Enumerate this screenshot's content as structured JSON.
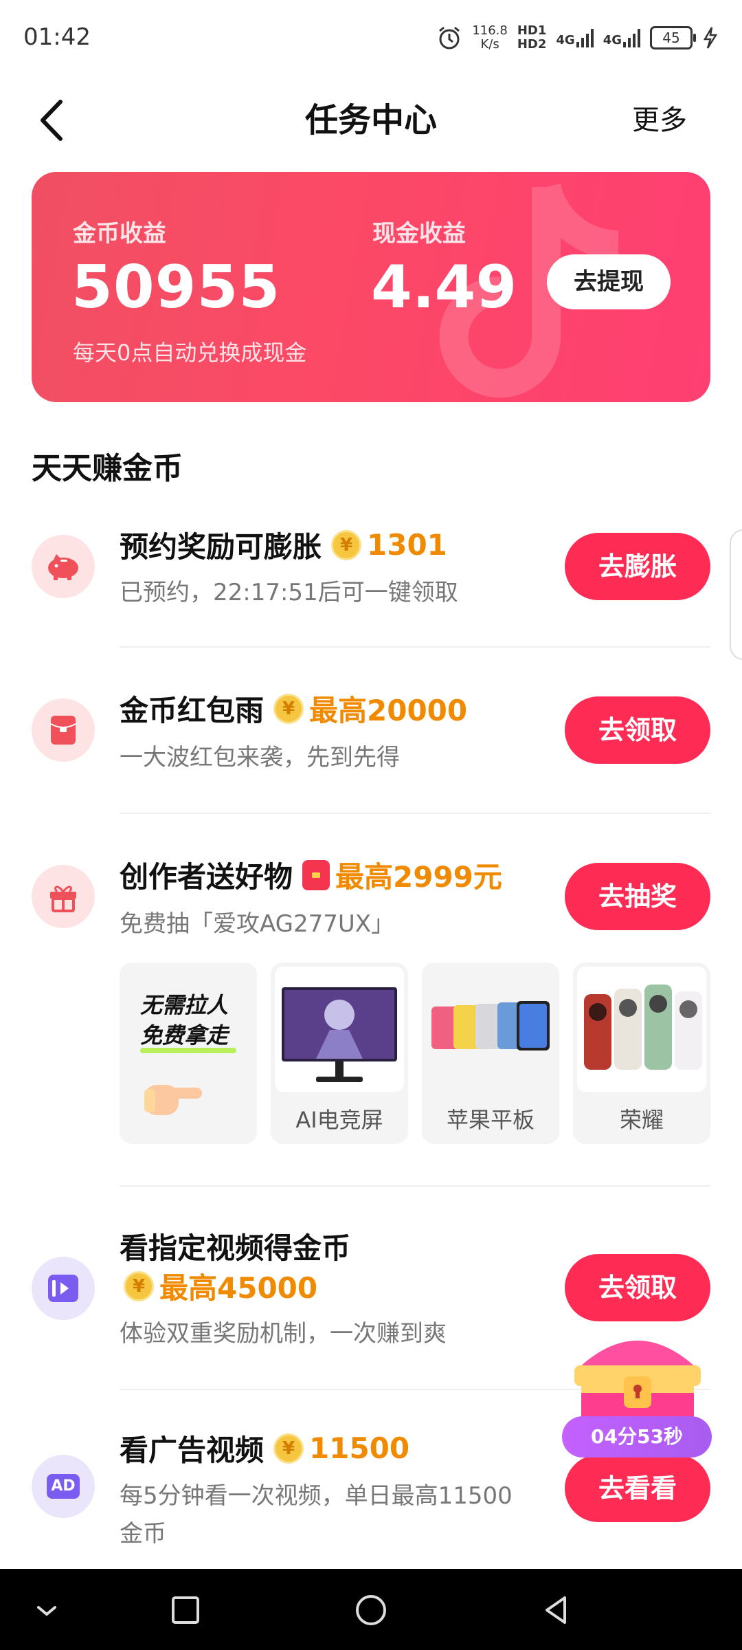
{
  "status_bar": {
    "time": "01:42",
    "net_speed_value": "116.8",
    "net_speed_unit": "K/s",
    "hd1": "HD1",
    "hd2": "HD2",
    "sig1": "4G",
    "sig2": "4G",
    "battery": "45"
  },
  "header": {
    "title": "任务中心",
    "more_label": "更多"
  },
  "earnings": {
    "coin_label": "金币收益",
    "coin_value": "50955",
    "cash_label": "现金收益",
    "cash_value": "4.49",
    "note": "每天0点自动兑换成现金",
    "withdraw_label": "去提现"
  },
  "section_title": "天天赚金币",
  "tasks": [
    {
      "title": "预约奖励可膨胀",
      "reward": "1301",
      "subtitle": "已预约，22:17:51后可一键领取",
      "button": "去膨胀"
    },
    {
      "title": "金币红包雨",
      "reward": "最高20000",
      "subtitle": "一大波红包来袭，先到先得",
      "button": "去领取"
    },
    {
      "title": "创作者送好物",
      "reward": "最高2999元",
      "subtitle": "免费抽「爱攻AG277UX」",
      "button": "去抽奖"
    },
    {
      "title": "看指定视频得金币",
      "reward": "最高45000",
      "subtitle": "体验双重奖励机制，一次赚到爽",
      "button": "去领取"
    },
    {
      "title": "看广告视频",
      "reward": "11500",
      "subtitle_line1": "每5分钟看一次视频，单日最高11500",
      "subtitle_line2": "金币",
      "button": "去看看"
    }
  ],
  "prizes": {
    "promo_line1": "无需拉人",
    "promo_line2": "免费拿走",
    "items": [
      "AI电竞屏",
      "苹果平板",
      "荣耀"
    ]
  },
  "chest": {
    "countdown": "04分53秒"
  },
  "icons": {
    "coin": "¥",
    "ad_badge": "AD"
  },
  "colors": {
    "accent": "#fe2c55",
    "reward": "#f08a00"
  }
}
